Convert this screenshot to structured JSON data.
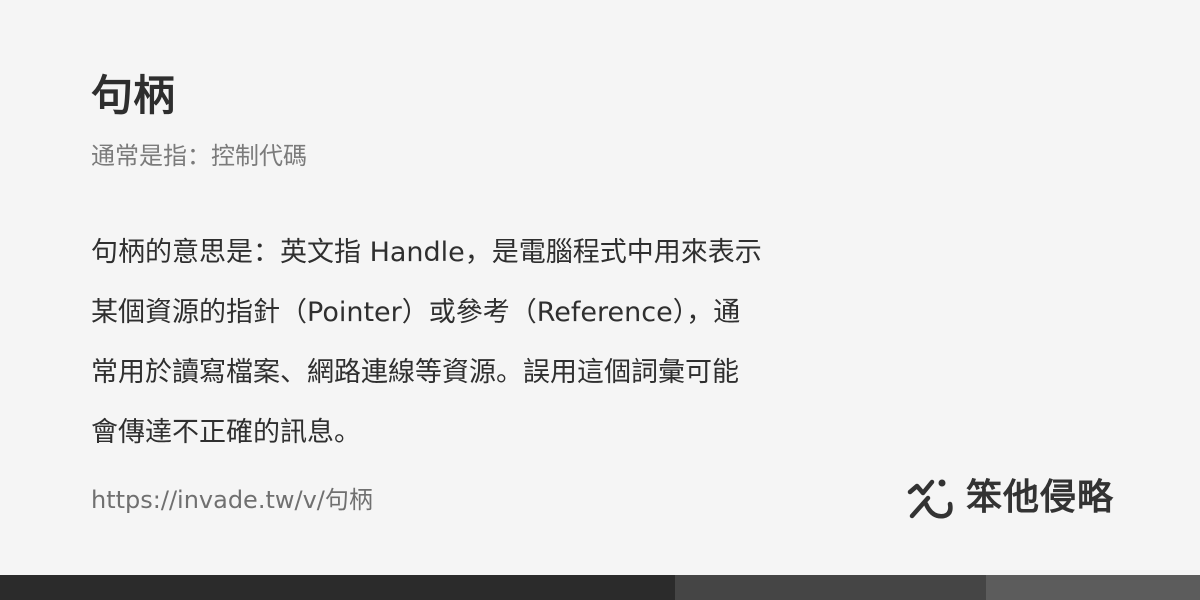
{
  "entry": {
    "title": "句柄",
    "subtitle": "通常是指：控制代碼",
    "definition_lines": [
      "句柄的意思是：英文指 Handle，是電腦程式中用來表示",
      "某個資源的指針（Pointer）或參考（Reference），通",
      "常用於讀寫檔案、網路連線等資源。誤用這個詞彙可能",
      "會傳達不正確的訊息。"
    ],
    "url": "https://invade.tw/v/句柄"
  },
  "brand": {
    "name": "笨他侵略",
    "icon": "brand-logo-icon"
  },
  "colors": {
    "background": "#f5f5f5",
    "title": "#2e2e2e",
    "subtitle": "#7b7b7b",
    "body": "#2f2f2f",
    "footer_1": "#2b2b2b",
    "footer_2": "#454545",
    "footer_3": "#5c5c5c"
  }
}
